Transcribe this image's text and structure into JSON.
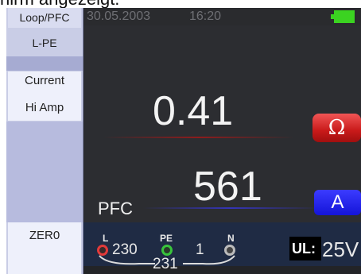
{
  "caption": "hirm angezeigt.",
  "sidebar": {
    "mode": "Loop/PFC",
    "sub_mode": "L-PE",
    "option1": "Current",
    "option2": "Hi Amp",
    "bottom": "ZER0"
  },
  "status": {
    "date": "30.05.2003",
    "time": "16:20"
  },
  "measurement": {
    "primary_value": "0.41",
    "primary_unit": "Ω",
    "secondary_label": "PFC",
    "secondary_value": "561",
    "secondary_unit": "A"
  },
  "terminals": {
    "l_label": "L",
    "pe_label": "PE",
    "n_label": "N",
    "l_pe_voltage": "230",
    "pe_n_voltage": "1",
    "l_n_voltage": "231",
    "ul_label": "UL:",
    "ul_value": "25V"
  },
  "colors": {
    "ohm_badge": "#d32424",
    "amp_badge": "#2323e0",
    "battery": "#3bd321",
    "sidebar": "#c9cde6"
  }
}
